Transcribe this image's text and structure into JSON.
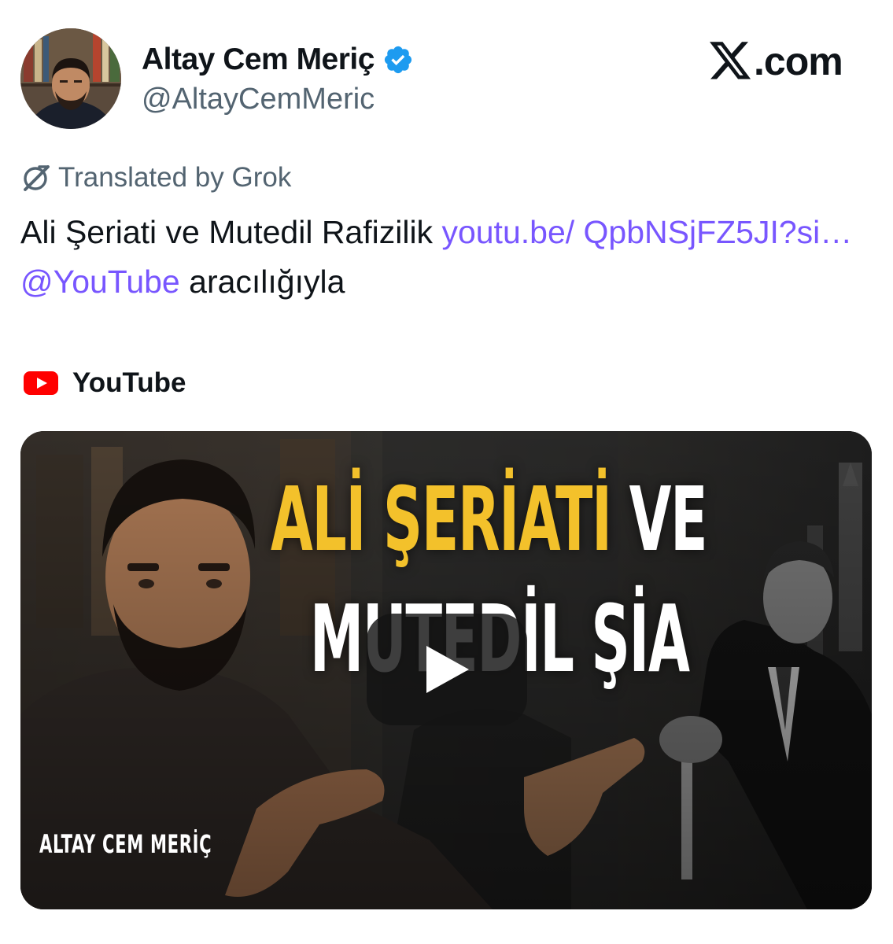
{
  "tweet": {
    "author": {
      "display_name": "Altay Cem Meriç",
      "handle": "@AltayCemMeric",
      "verified": true,
      "verified_icon": "verified-badge-icon"
    },
    "site_logo": {
      "icon": "x-logo-icon",
      "text": ".com"
    },
    "translation_notice": {
      "icon": "grok-icon",
      "text": "Translated by Grok"
    },
    "text": {
      "part1": "Ali Şeriati ve Mutedil Rafizilik ",
      "link_url": "youtu.be/ QpbNSjFZ5JI?si…",
      "space": " ",
      "mention": "@YouTube",
      "part2": " aracılığıyla"
    },
    "link_preview": {
      "source_icon": "youtube-icon",
      "source_name": "YouTube",
      "thumbnail": {
        "title_word1": "ALİ ŞERİATİ",
        "title_word2": " VE",
        "title_line2": "MUTEDİL ŞİA",
        "channel_label": "ALTAY CEM MERİÇ",
        "play_icon": "play-icon"
      }
    },
    "colors": {
      "link": "#7856ff",
      "verified": "#1d9bf0",
      "secondary_text": "#536471",
      "youtube_red": "#ff0000",
      "thumbnail_title_yellow": "#f3c12b"
    }
  }
}
